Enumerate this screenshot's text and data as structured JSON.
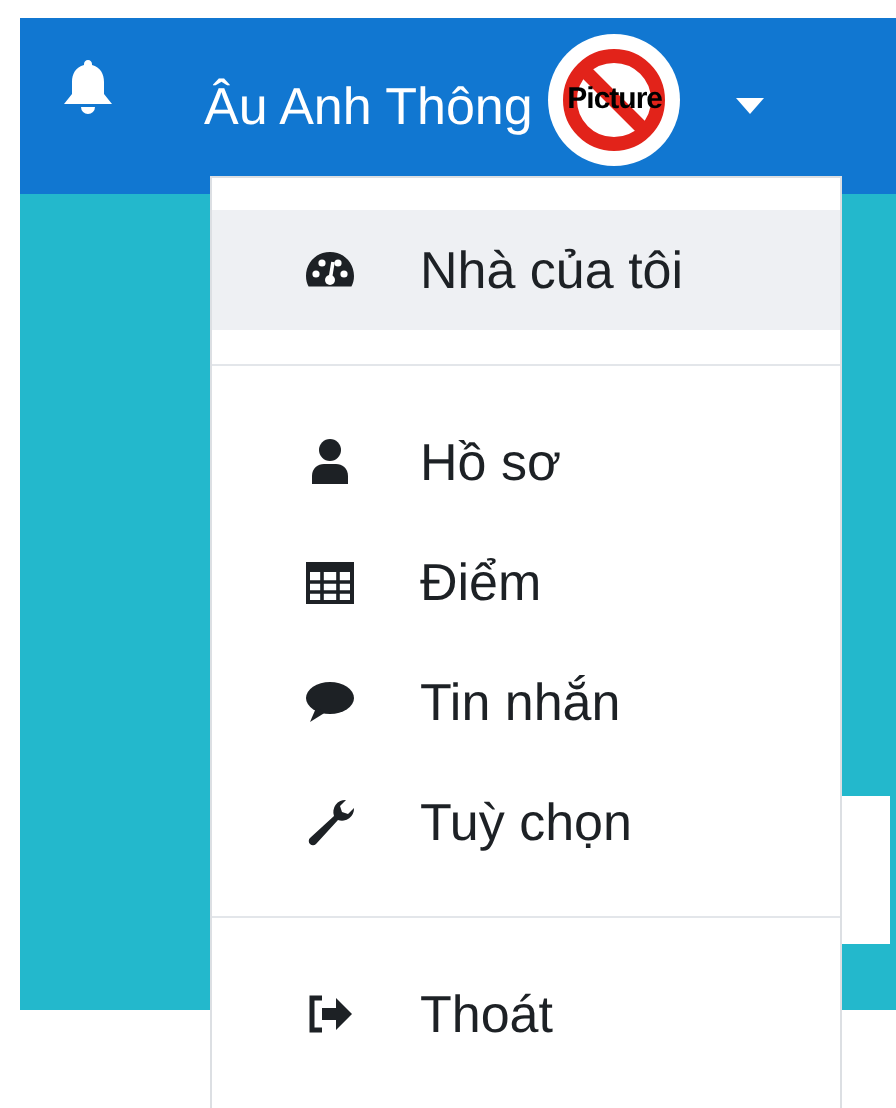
{
  "navbar": {
    "user_name": "Âu Anh Thông",
    "avatar": {
      "label": "Picture"
    }
  },
  "user_menu": {
    "items": [
      {
        "kind": "link",
        "label": "Nhà của tôi",
        "selected": true
      },
      {
        "kind": "divider"
      },
      {
        "kind": "link",
        "label": "Hồ sơ",
        "selected": false
      },
      {
        "kind": "link",
        "label": "Điểm",
        "selected": false
      },
      {
        "kind": "link",
        "label": "Tin nhắn",
        "selected": false
      },
      {
        "kind": "link",
        "label": "Tuỳ chọn",
        "selected": false
      },
      {
        "kind": "divider"
      },
      {
        "kind": "link",
        "label": "Thoát",
        "selected": false
      }
    ]
  }
}
